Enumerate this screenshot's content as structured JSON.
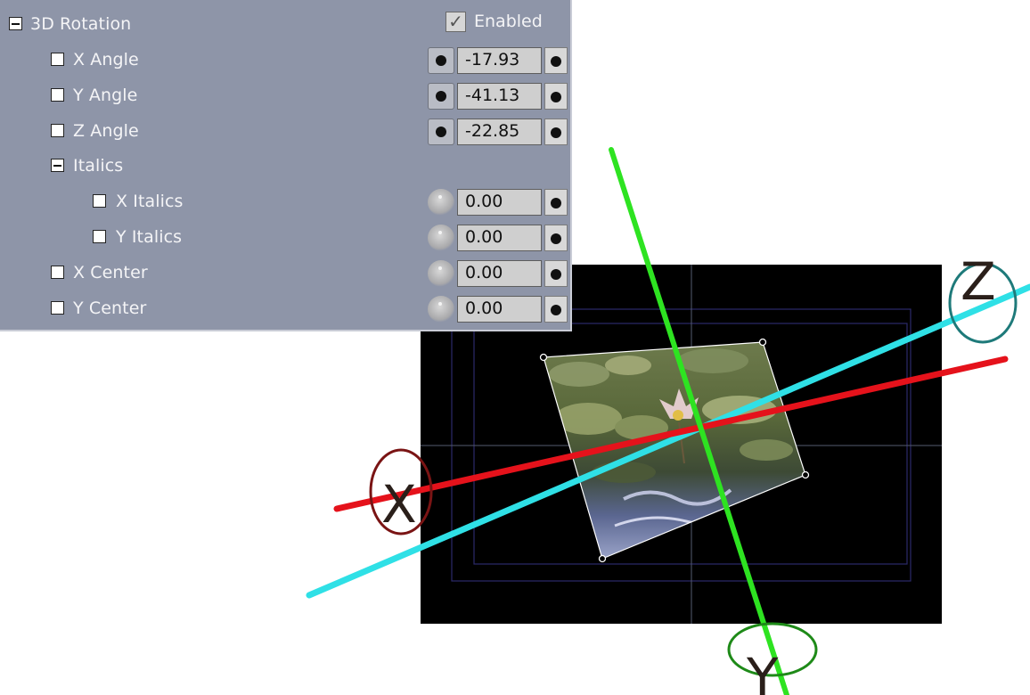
{
  "panel": {
    "title": "3D Rotation",
    "enabled_label": "Enabled",
    "enabled_mark": "✓",
    "params": {
      "x_angle": {
        "label": "X Angle",
        "value": "-17.93"
      },
      "y_angle": {
        "label": "Y Angle",
        "value": "-41.13"
      },
      "z_angle": {
        "label": "Z Angle",
        "value": "-22.85"
      },
      "italics": {
        "label": "Italics"
      },
      "x_italics": {
        "label": "X Italics",
        "value": "0.00"
      },
      "y_italics": {
        "label": "Y Italics",
        "value": "0.00"
      },
      "x_center": {
        "label": "X Center",
        "value": "0.00"
      },
      "y_center": {
        "label": "Y Center",
        "value": "0.00"
      }
    }
  },
  "axes": {
    "x": {
      "label": "X",
      "color": "#e5121b"
    },
    "y": {
      "label": "Y",
      "color": "#2ee321"
    },
    "z": {
      "label": "Z",
      "color": "#2fe0e6"
    }
  },
  "colors": {
    "panel_bg": "#8e95a8",
    "viewport_bg": "#000000",
    "x_ring": "#7a1414",
    "y_ring": "#1e8a18",
    "z_ring": "#1e7a7a"
  }
}
